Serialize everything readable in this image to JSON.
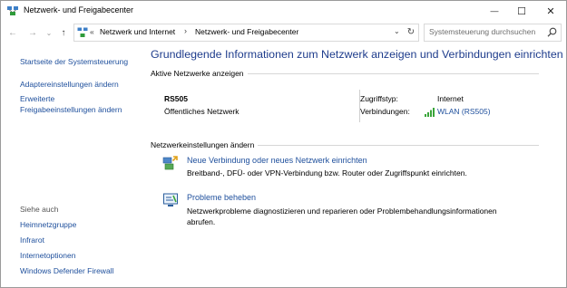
{
  "window": {
    "title": "Netzwerk- und Freigabecenter",
    "controls": {
      "minimize": "—",
      "maximize": "☐",
      "close": "✕"
    }
  },
  "navigation": {
    "back": "←",
    "forward": "→",
    "dropdown": "⌄",
    "up": "↑",
    "overflow": "«",
    "breadcrumb": [
      "Netzwerk und Internet",
      "Netzwerk- und Freigabecenter"
    ],
    "separator": "›",
    "refresh": "↻",
    "search_placeholder": "Systemsteuerung durchsuchen"
  },
  "sidebar": {
    "items": [
      "Startseite der Systemsteuerung",
      "Adaptereinstellungen ändern",
      "Erweiterte",
      "Freigabeeinstellungen ändern"
    ],
    "see_also_label": "Siehe auch",
    "see_also": [
      "Heimnetzgruppe",
      "Infrarot",
      "Internetoptionen",
      "Windows Defender Firewall"
    ]
  },
  "main": {
    "heading": "Grundlegende Informationen zum Netzwerk anzeigen und Verbindungen einrichten",
    "active_networks_label": "Aktive Netzwerke anzeigen",
    "network": {
      "name": "RS505",
      "type": "Öffentliches Netzwerk",
      "access_type_label": "Zugriffstyp:",
      "access_type_value": "Internet",
      "connections_label": "Verbindungen:",
      "connection_value": "WLAN (RS505)"
    },
    "change_settings_label": "Netzwerkeinstellungen ändern",
    "tasks": [
      {
        "title": "Neue Verbindung oder neues Netzwerk einrichten",
        "desc1": "Breitband-, DFÜ- oder VPN-Verbindung bzw. Router oder Zugriffspunkt einrichten.",
        "desc2": ""
      },
      {
        "title": "Probleme beheben",
        "desc1": "Netzwerkprobleme diagnostizieren und reparieren oder Problembehandlungsinformationen",
        "desc2": "abrufen."
      }
    ]
  },
  "colors": {
    "link": "#1e4f9c",
    "heading": "#1e3c8c",
    "wifi": "#3aa53a"
  },
  "icons": [
    "network-center-icon",
    "search-icon",
    "wifi-signal-icon",
    "new-connection-icon",
    "troubleshoot-icon"
  ]
}
